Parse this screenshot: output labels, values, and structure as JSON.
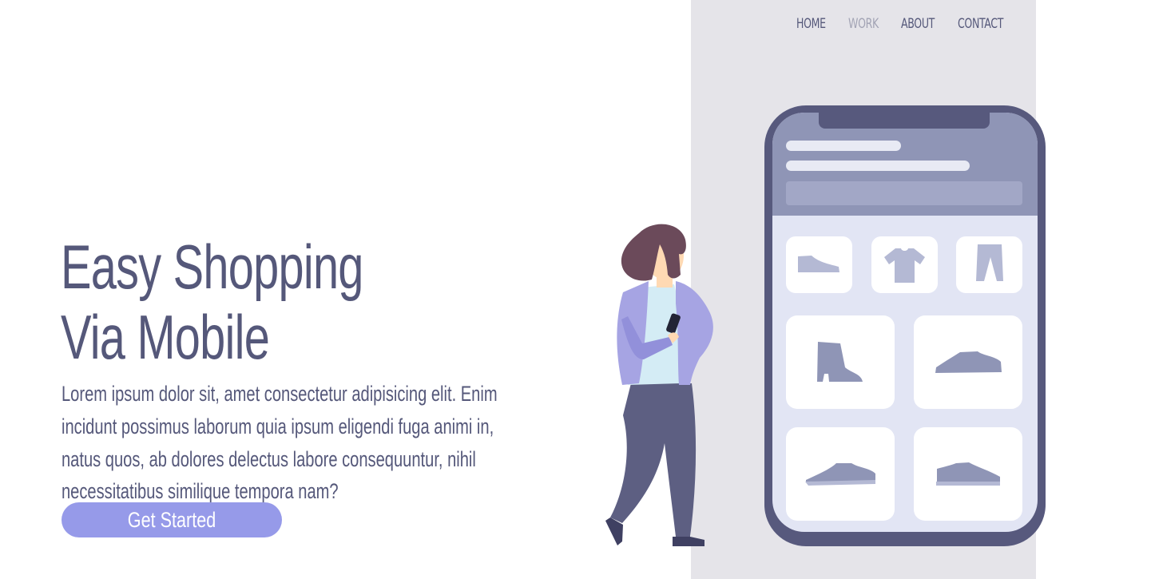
{
  "nav": {
    "items": [
      {
        "label": "HOME"
      },
      {
        "label": "WORK"
      },
      {
        "label": "ABOUT"
      },
      {
        "label": "CONTACT"
      }
    ],
    "active": "WORK"
  },
  "hero": {
    "title_line1": "Easy Shopping",
    "title_line2": "Via Mobile",
    "body": "Lorem ipsum dolor sit, amet consectetur adipisicing elit. Enim incidunt possimus laborum quia ipsum eligendi fuga animi in, natus quos, ab dolores delectus labore consequuntur, nihil necessitatibus similique tempora nam?",
    "cta_label": "Get Started"
  },
  "colors": {
    "text": "#55587a",
    "accent": "#969ae9",
    "panel": "#e5e4e9",
    "nav_active": "#a2a3b4"
  },
  "illustration": {
    "icons": [
      "shoe-icon",
      "tshirt-icon",
      "pants-icon",
      "boot-icon",
      "sneaker-icon",
      "shoe-icon",
      "shoe-icon"
    ]
  }
}
